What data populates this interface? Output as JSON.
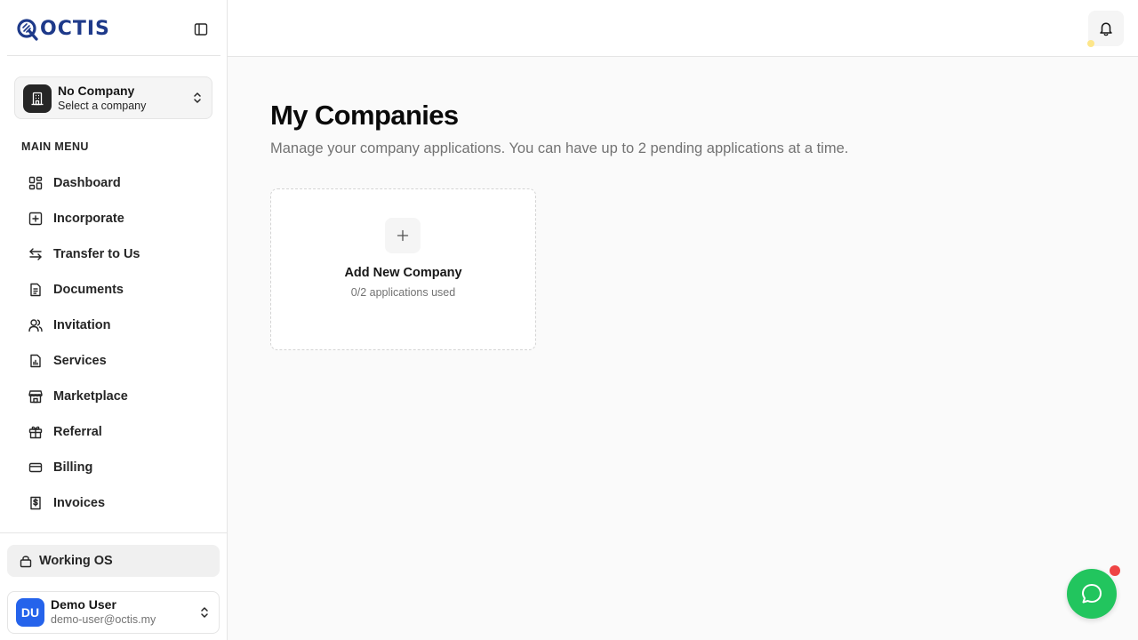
{
  "brand": {
    "logo_text": "OCTIS",
    "accent_color": "#1e3a8a"
  },
  "sidebar": {
    "toggle_icon": "sidebar-panel-icon",
    "company_switcher": {
      "name": "No Company",
      "subtitle": "Select a company",
      "icon": "building-icon"
    },
    "menu_label": "MAIN MENU",
    "items": [
      {
        "label": "Dashboard",
        "icon": "dashboard-icon"
      },
      {
        "label": "Incorporate",
        "icon": "plus-square-icon"
      },
      {
        "label": "Transfer to Us",
        "icon": "arrows-left-right-icon"
      },
      {
        "label": "Documents",
        "icon": "document-icon"
      },
      {
        "label": "Invitation",
        "icon": "users-icon"
      },
      {
        "label": "Services",
        "icon": "file-chart-icon"
      },
      {
        "label": "Marketplace",
        "icon": "store-icon"
      },
      {
        "label": "Referral",
        "icon": "gift-icon"
      },
      {
        "label": "Billing",
        "icon": "credit-card-icon"
      },
      {
        "label": "Invoices",
        "icon": "receipt-dollar-icon"
      }
    ],
    "working_os": {
      "label": "Working OS",
      "icon": "lock-icon"
    },
    "user": {
      "initials": "DU",
      "name": "Demo User",
      "email": "demo-user@octis.my",
      "avatar_color": "#2563eb"
    }
  },
  "header": {
    "bell_icon": "bell-icon",
    "notification_dot_color": "#fde68a"
  },
  "main": {
    "title": "My Companies",
    "subtitle": "Manage your company applications. You can have up to 2 pending applications at a time.",
    "add_card": {
      "title": "Add New Company",
      "usage": "0/2 applications used",
      "icon": "plus-icon"
    }
  },
  "chat": {
    "icon": "chat-bubble-icon",
    "color": "#22c55e",
    "badge_color": "#ef4444"
  }
}
